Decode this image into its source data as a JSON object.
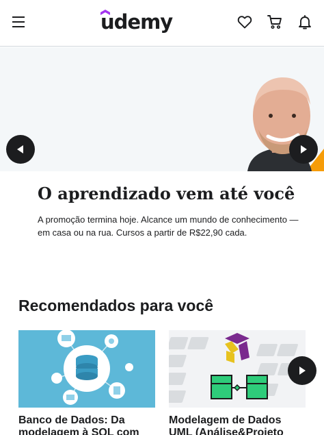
{
  "header": {
    "logo_text": "udemy",
    "menu_icon": "hamburger-menu-icon",
    "wishlist_icon": "heart-icon",
    "cart_icon": "cart-icon",
    "notifications_icon": "bell-icon",
    "brand_color": "#a435f0"
  },
  "hero": {
    "title": "O aprendizado vem até você",
    "description": "A promoção termina hoje. Alcance um mundo de conhecimento — em casa ou na rua. Cursos a partir de R$22,90 cada.",
    "prev_icon": "chevron-left-icon",
    "next_icon": "chevron-right-icon",
    "accent_color": "#f69c08"
  },
  "recommendations": {
    "title": "Recomendados para você",
    "next_icon": "chevron-right-icon",
    "courses": [
      {
        "title": "Banco de Dados: Da modelagem à SQL com",
        "thumb_color": "#5db8d8"
      },
      {
        "title": "Modelagem de Dados UML (Análise&Projeto Orientado",
        "thumb_color": "#f2f3f5"
      }
    ]
  }
}
